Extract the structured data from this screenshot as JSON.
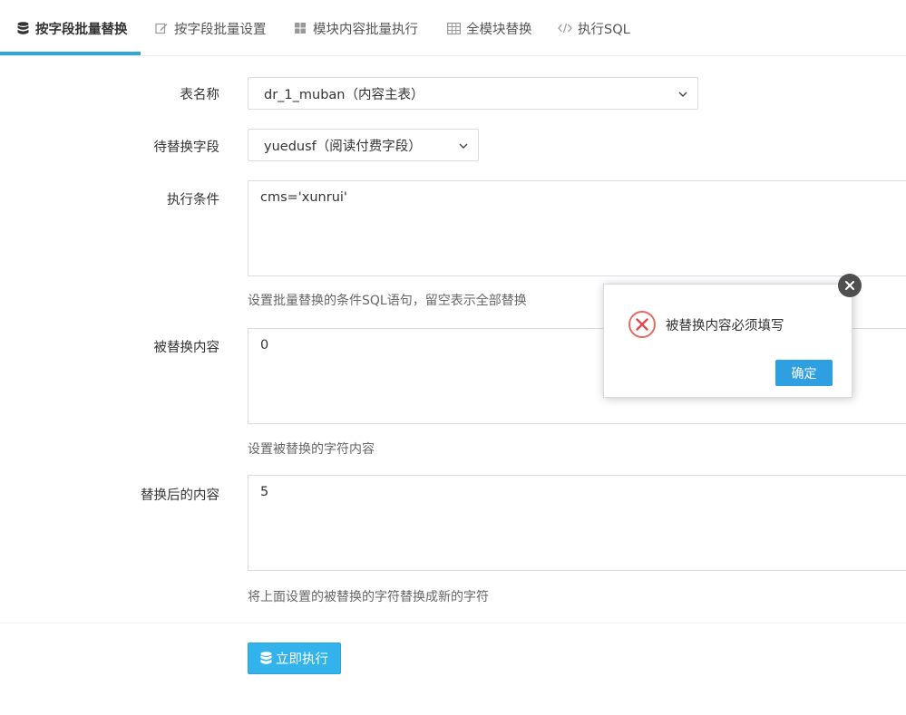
{
  "tabs": [
    {
      "label": "按字段批量替换",
      "icon": "database-icon",
      "active": true
    },
    {
      "label": "按字段批量设置",
      "icon": "edit-icon",
      "active": false
    },
    {
      "label": "模块内容批量执行",
      "icon": "grid-icon",
      "active": false
    },
    {
      "label": "全模块替换",
      "icon": "table-icon",
      "active": false
    },
    {
      "label": "执行SQL",
      "icon": "code-icon",
      "active": false
    }
  ],
  "form": {
    "table": {
      "label": "表名称",
      "value": "dr_1_muban（内容主表）"
    },
    "field": {
      "label": "待替换字段",
      "value": "yuedusf（阅读付费字段）"
    },
    "condition": {
      "label": "执行条件",
      "value": "cms='xunrui'",
      "help": "设置批量替换的条件SQL语句，留空表示全部替换"
    },
    "search": {
      "label": "被替换内容",
      "value": "0",
      "help": "设置被替换的字符内容"
    },
    "replace": {
      "label": "替换后的内容",
      "value": "5",
      "help": "将上面设置的被替换的字符替换成新的字符"
    },
    "submit_label": "立即执行"
  },
  "dialog": {
    "message": "被替换内容必须填写",
    "ok_label": "确定",
    "icon": "error-x-icon"
  },
  "colors": {
    "accent": "#32a5dc",
    "button": "#32b3ec",
    "error": "#e04b4b"
  }
}
